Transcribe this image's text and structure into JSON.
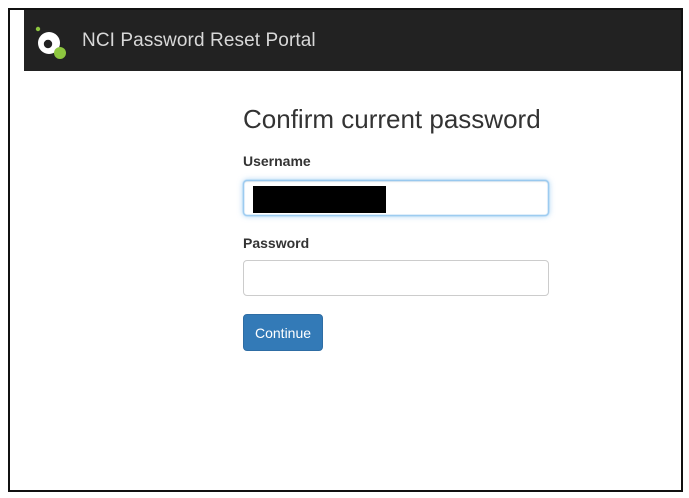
{
  "navbar": {
    "logo_icon": "nci-logo-icon",
    "brand": "NCI Password Reset Portal",
    "background": "#222222"
  },
  "form": {
    "title": "Confirm current password",
    "username_label": "Username",
    "username_value": "",
    "password_label": "Password",
    "password_value": "",
    "submit_label": "Continue",
    "accent": "#337ab7"
  }
}
